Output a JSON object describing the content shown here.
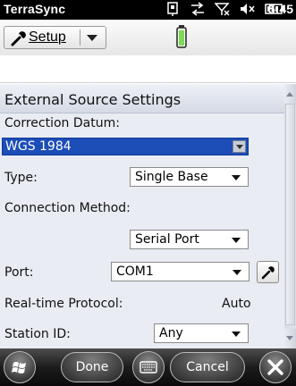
{
  "status_bar": {
    "app_name": "TerraSync",
    "time": "5:45",
    "icons": [
      "phone-signal-icon",
      "connectivity-icon",
      "no-signal-icon",
      "volume-icon",
      "battery-icon"
    ]
  },
  "toolbar": {
    "setup_label": "Setup",
    "setup_icon": "wrench-icon",
    "status_icon": "gps-battery-icon"
  },
  "panel": {
    "title": "External Source Settings",
    "correction_datum_label": "Correction Datum:",
    "correction_datum_value": "WGS 1984",
    "type_label": "Type:",
    "type_value": "Single Base",
    "connection_method_label": "Connection Method:",
    "connection_method_value": "Serial Port",
    "port_label": "Port:",
    "port_value": "COM1",
    "protocol_label": "Real-time Protocol:",
    "protocol_value": "Auto",
    "station_id_label": "Station ID:",
    "station_id_value": "Any"
  },
  "softkeys": {
    "done_label": "Done",
    "cancel_label": "Cancel"
  },
  "colors": {
    "selection": "#1d4db7",
    "panel_bg": "#e9ecf3",
    "softbar_bg": "#1c1c1c"
  }
}
